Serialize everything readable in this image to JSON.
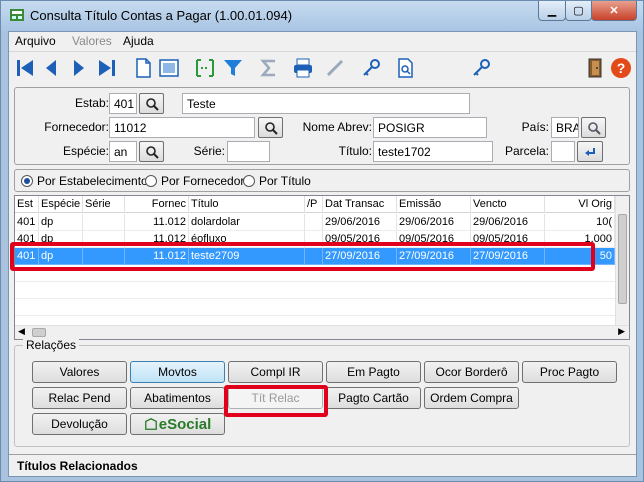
{
  "window": {
    "title": "Consulta Título Contas a Pagar (1.00.01.094)",
    "min_glyph": "▁",
    "max_glyph": "▢",
    "close_glyph": "✕"
  },
  "menu": {
    "items": [
      "Arquivo",
      "Valores",
      "Ajuda"
    ]
  },
  "toolbar": {
    "icons": [
      "first-icon",
      "prev-icon",
      "next-icon",
      "last-icon",
      "new-doc-icon",
      "preview-icon",
      "select-range-icon",
      "filter-icon",
      "sum-icon",
      "print-icon",
      "pen-icon",
      "key-icon",
      "doc-search-icon",
      "key2-icon",
      "exit-door-icon",
      "help-icon"
    ]
  },
  "filters": {
    "estab_label": "Estab:",
    "estab_value": "401",
    "estab_name": "Teste",
    "fornecedor_label": "Fornecedor:",
    "fornecedor_value": "11012",
    "nome_abrev_label": "Nome Abrev:",
    "nome_abrev_value": "POSIGR",
    "pais_label": "País:",
    "pais_value": "BRA",
    "especie_label": "Espécie:",
    "especie_value": "an",
    "serie_label": "Série:",
    "serie_value": "",
    "titulo_label": "Título:",
    "titulo_value": "teste1702",
    "parcela_label": "Parcela:",
    "parcela_value": ""
  },
  "order": {
    "options": [
      "Por Estabelecimento",
      "Por Fornecedor",
      "Por Título"
    ],
    "selected": 0
  },
  "grid": {
    "columns": [
      "Est",
      "Espécie",
      "Série",
      "Fornec",
      "Título",
      "/P",
      "Dat Transac",
      "Emissão",
      "Vencto",
      "Vl Orig"
    ],
    "rows": [
      [
        "401",
        "dp",
        "",
        "11.012",
        "dolardolar",
        "",
        "29/06/2016",
        "29/06/2016",
        "29/06/2016",
        "10("
      ],
      [
        "401",
        "dp",
        "",
        "11.012",
        "éofluxo",
        "",
        "09/05/2016",
        "09/05/2016",
        "09/05/2016",
        "1.000"
      ],
      [
        "401",
        "dp",
        "",
        "11.012",
        "teste2709",
        "",
        "27/09/2016",
        "27/09/2016",
        "27/09/2016",
        "50"
      ]
    ],
    "selected_row": 2
  },
  "relacoes": {
    "title": "Relações",
    "buttons": [
      "Valores",
      "Movtos",
      "Compl IR",
      "Em Pagto",
      "Ocor Borderô",
      "Proc Pagto",
      "Relac Pend",
      "Abatimentos",
      "Tít Relac",
      "Pagto Cartão",
      "Ordem Compra",
      "Devolução",
      "eSocial"
    ]
  },
  "status": {
    "text": "Títulos Relacionados"
  },
  "colors": {
    "highlight": "#e0001b",
    "selection": "#3399ff"
  }
}
